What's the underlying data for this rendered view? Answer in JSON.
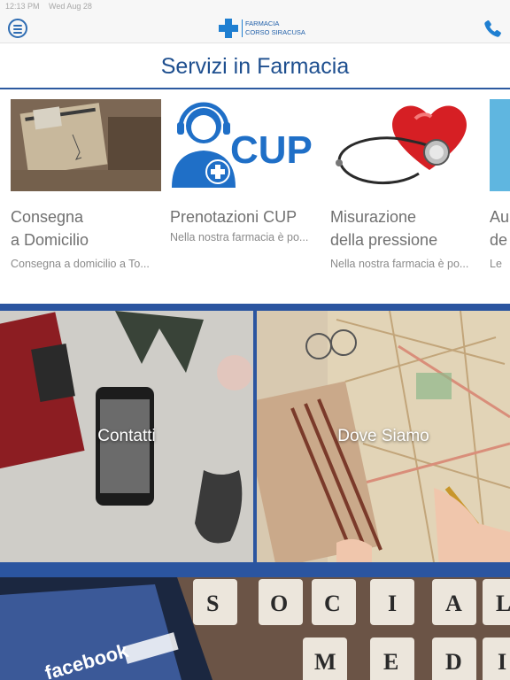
{
  "status": {
    "time": "12:13 PM",
    "date": "Wed Aug 28"
  },
  "header": {
    "logo_line1": "FARMACIA",
    "logo_line2": "CORSO SIRACUSA",
    "accent": "#1f7fd1",
    "menu_icon": "hamburger-icon",
    "phone_icon": "phone-icon"
  },
  "title": "Servizi in Farmacia",
  "services": [
    {
      "title_line1": "Consegna",
      "title_line2": "a Domicilio",
      "desc": "Consegna a domicilio a To..."
    },
    {
      "title_line1": "Prenotazioni CUP",
      "title_line2": "",
      "desc": "Nella nostra farmacia è po..."
    },
    {
      "title_line1": "Misurazione",
      "title_line2": "della pressione",
      "desc": "Nella nostra farmacia è po..."
    },
    {
      "title_line1": "Au",
      "title_line2": "de",
      "desc": "Le"
    }
  ],
  "cup_logo_text": "CUP",
  "tiles": {
    "contatti": "Contatti",
    "dove_siamo": "Dove Siamo",
    "social_letters": [
      "S",
      "O",
      "C",
      "I",
      "A",
      "L",
      "M",
      "E",
      "D",
      "I"
    ],
    "facebook": "facebook"
  }
}
